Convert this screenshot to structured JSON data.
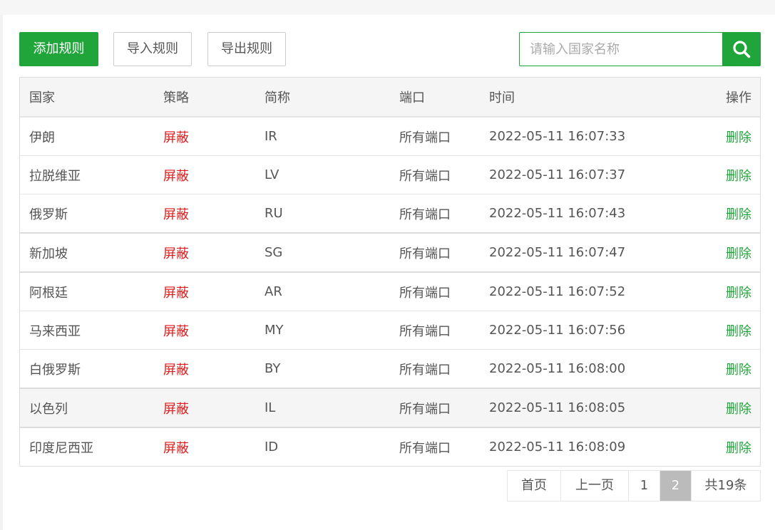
{
  "toolbar": {
    "add_label": "添加规则",
    "import_label": "导入规则",
    "export_label": "导出规则"
  },
  "search": {
    "placeholder": "请输入国家名称",
    "value": "",
    "icon": "search-icon"
  },
  "colors": {
    "accent": "#20a53a",
    "policy": "#e01c1c"
  },
  "table": {
    "headers": {
      "country": "国家",
      "policy": "策略",
      "abbr": "简称",
      "port": "端口",
      "time": "时间",
      "op": "操作"
    },
    "rows": [
      {
        "country": "伊朗",
        "policy": "屏蔽",
        "abbr": "IR",
        "port": "所有端口",
        "time": "2022-05-11 16:07:33",
        "op": "删除"
      },
      {
        "country": "拉脱维亚",
        "policy": "屏蔽",
        "abbr": "LV",
        "port": "所有端口",
        "time": "2022-05-11 16:07:37",
        "op": "删除"
      },
      {
        "country": "俄罗斯",
        "policy": "屏蔽",
        "abbr": "RU",
        "port": "所有端口",
        "time": "2022-05-11 16:07:43",
        "op": "删除"
      },
      {
        "country": "新加坡",
        "policy": "屏蔽",
        "abbr": "SG",
        "port": "所有端口",
        "time": "2022-05-11 16:07:47",
        "op": "删除"
      },
      {
        "country": "阿根廷",
        "policy": "屏蔽",
        "abbr": "AR",
        "port": "所有端口",
        "time": "2022-05-11 16:07:52",
        "op": "删除"
      },
      {
        "country": "马来西亚",
        "policy": "屏蔽",
        "abbr": "MY",
        "port": "所有端口",
        "time": "2022-05-11 16:07:56",
        "op": "删除"
      },
      {
        "country": "白俄罗斯",
        "policy": "屏蔽",
        "abbr": "BY",
        "port": "所有端口",
        "time": "2022-05-11 16:08:00",
        "op": "删除"
      },
      {
        "country": "以色列",
        "policy": "屏蔽",
        "abbr": "IL",
        "port": "所有端口",
        "time": "2022-05-11 16:08:05",
        "op": "删除"
      },
      {
        "country": "印度尼西亚",
        "policy": "屏蔽",
        "abbr": "ID",
        "port": "所有端口",
        "time": "2022-05-11 16:08:09",
        "op": "删除"
      }
    ]
  },
  "pagination": {
    "first": "首页",
    "prev": "上一页",
    "pages": [
      "1",
      "2"
    ],
    "current": "2",
    "total": "共19条"
  }
}
